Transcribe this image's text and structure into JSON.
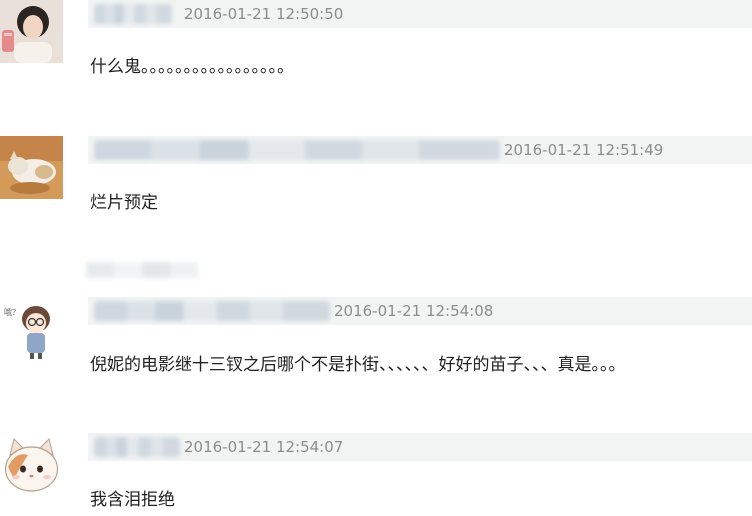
{
  "comments": [
    {
      "timestamp": "2016-01-21 12:50:50",
      "text": "什么鬼。。。。。。。。。。。。。。。。。",
      "avatar_icon": "girl-avatar"
    },
    {
      "timestamp": "2016-01-21 12:51:49",
      "text": "烂片预定",
      "avatar_icon": "cat-photo-avatar"
    },
    {
      "timestamp": "2016-01-21 12:54:08",
      "text": "倪妮的电影继十三钗之后哪个不是扑街、、、、、、好好的苗子、、、真是。。。",
      "avatar_icon": "cartoon-girl-avatar"
    },
    {
      "timestamp": "2016-01-21 12:54:07",
      "text": "我含泪拒绝",
      "avatar_icon": "cartoon-cat-avatar"
    }
  ]
}
